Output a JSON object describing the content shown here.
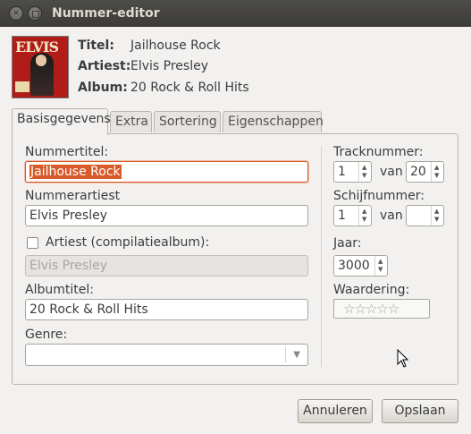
{
  "window": {
    "title": "Nummer-editor",
    "close_glyph": "×"
  },
  "header": {
    "title_label": "Titel:",
    "title_value": "Jailhouse Rock",
    "artist_label": "Artiest:",
    "artist_value": "Elvis Presley",
    "album_label": "Album:",
    "album_value": "20 Rock & Roll Hits",
    "cover_logo": "ELVIS"
  },
  "tabs": [
    {
      "label": "Basisgegevens",
      "active": true
    },
    {
      "label": "Extra",
      "active": false
    },
    {
      "label": "Sortering",
      "active": false
    },
    {
      "label": "Eigenschappen",
      "active": false
    }
  ],
  "basic": {
    "track_title_label": "Nummertitel:",
    "track_title_value": "Jailhouse Rock",
    "track_artist_label": "Nummerartiest",
    "track_artist_value": "Elvis Presley",
    "compilation_label": "Artiest (compilatiealbum):",
    "compilation_checked": false,
    "compilation_value": "Elvis Presley",
    "album_title_label": "Albumtitel:",
    "album_title_value": "20 Rock & Roll Hits",
    "genre_label": "Genre:",
    "genre_value": ""
  },
  "side": {
    "track_number_label": "Tracknummer:",
    "track_number_value": "1",
    "of_label_1": "van",
    "track_total_value": "20",
    "disc_number_label": "Schijfnummer:",
    "disc_number_value": "1",
    "of_label_2": "van",
    "disc_total_value": "",
    "year_label": "Jaar:",
    "year_value": "3000",
    "rating_label": "Waardering:",
    "rating_stars": "☆☆☆☆☆",
    "rating_value": 0
  },
  "buttons": {
    "cancel": "Annuleren",
    "save": "Opslaan"
  },
  "icons": {
    "spin_up": "▲",
    "spin_down": "▼",
    "combo_arrow": "▼"
  }
}
